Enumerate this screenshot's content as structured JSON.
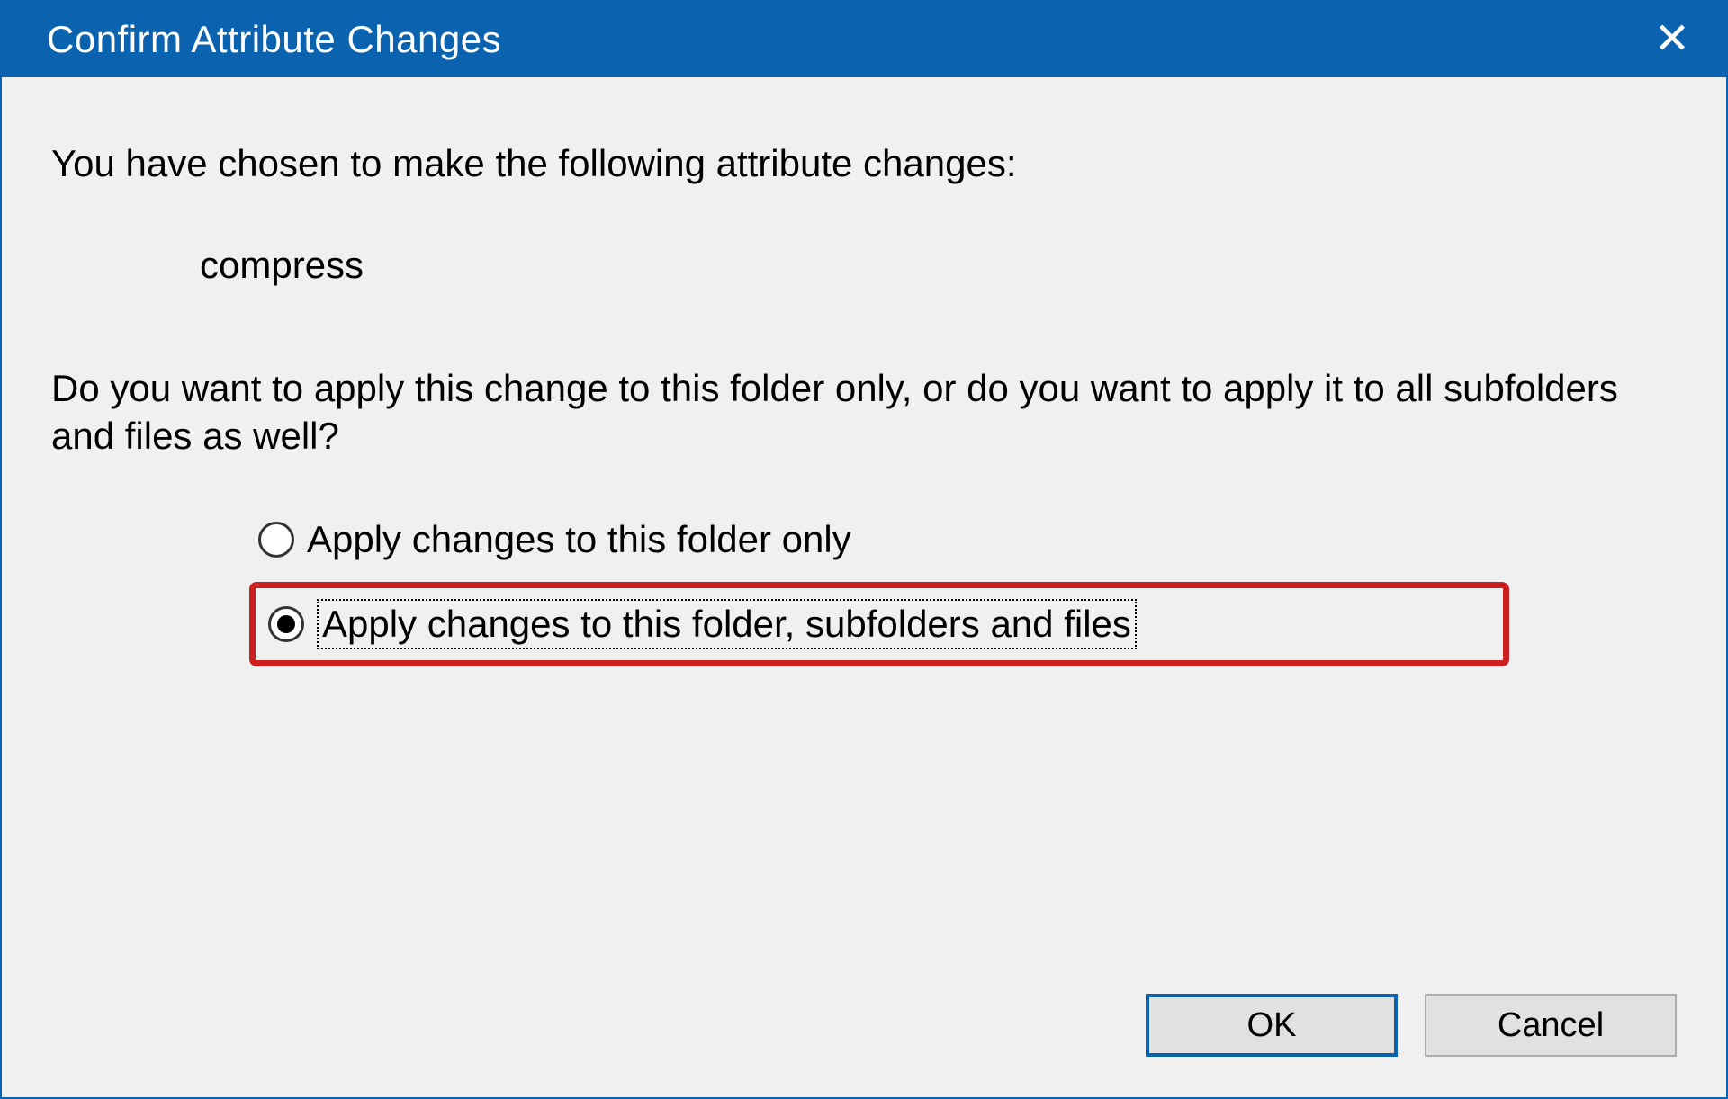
{
  "titlebar": {
    "title": "Confirm Attribute Changes"
  },
  "content": {
    "intro": "You have chosen to make the following attribute changes:",
    "attribute": "compress",
    "question": "Do you want to apply this change to this folder only, or do you want to apply it to all subfolders and files as well?",
    "options": {
      "folder_only": "Apply changes to this folder only",
      "all": "Apply changes to this folder, subfolders and files"
    }
  },
  "buttons": {
    "ok": "OK",
    "cancel": "Cancel"
  }
}
